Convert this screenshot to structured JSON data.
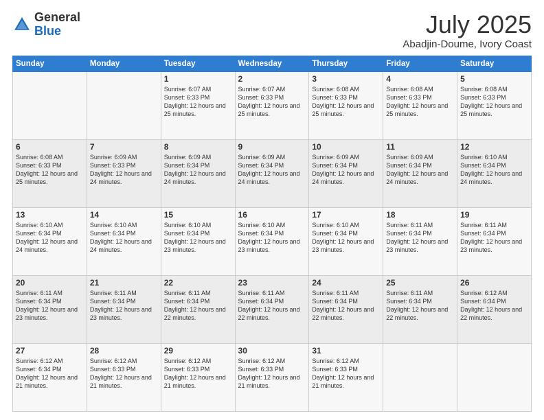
{
  "logo": {
    "line1": "General",
    "line2": "Blue"
  },
  "header": {
    "month": "July 2025",
    "location": "Abadjin-Doume, Ivory Coast"
  },
  "weekdays": [
    "Sunday",
    "Monday",
    "Tuesday",
    "Wednesday",
    "Thursday",
    "Friday",
    "Saturday"
  ],
  "weeks": [
    [
      {
        "day": "",
        "sunrise": "",
        "sunset": "",
        "daylight": ""
      },
      {
        "day": "",
        "sunrise": "",
        "sunset": "",
        "daylight": ""
      },
      {
        "day": "1",
        "sunrise": "Sunrise: 6:07 AM",
        "sunset": "Sunset: 6:33 PM",
        "daylight": "Daylight: 12 hours and 25 minutes."
      },
      {
        "day": "2",
        "sunrise": "Sunrise: 6:07 AM",
        "sunset": "Sunset: 6:33 PM",
        "daylight": "Daylight: 12 hours and 25 minutes."
      },
      {
        "day": "3",
        "sunrise": "Sunrise: 6:08 AM",
        "sunset": "Sunset: 6:33 PM",
        "daylight": "Daylight: 12 hours and 25 minutes."
      },
      {
        "day": "4",
        "sunrise": "Sunrise: 6:08 AM",
        "sunset": "Sunset: 6:33 PM",
        "daylight": "Daylight: 12 hours and 25 minutes."
      },
      {
        "day": "5",
        "sunrise": "Sunrise: 6:08 AM",
        "sunset": "Sunset: 6:33 PM",
        "daylight": "Daylight: 12 hours and 25 minutes."
      }
    ],
    [
      {
        "day": "6",
        "sunrise": "Sunrise: 6:08 AM",
        "sunset": "Sunset: 6:33 PM",
        "daylight": "Daylight: 12 hours and 25 minutes."
      },
      {
        "day": "7",
        "sunrise": "Sunrise: 6:09 AM",
        "sunset": "Sunset: 6:33 PM",
        "daylight": "Daylight: 12 hours and 24 minutes."
      },
      {
        "day": "8",
        "sunrise": "Sunrise: 6:09 AM",
        "sunset": "Sunset: 6:34 PM",
        "daylight": "Daylight: 12 hours and 24 minutes."
      },
      {
        "day": "9",
        "sunrise": "Sunrise: 6:09 AM",
        "sunset": "Sunset: 6:34 PM",
        "daylight": "Daylight: 12 hours and 24 minutes."
      },
      {
        "day": "10",
        "sunrise": "Sunrise: 6:09 AM",
        "sunset": "Sunset: 6:34 PM",
        "daylight": "Daylight: 12 hours and 24 minutes."
      },
      {
        "day": "11",
        "sunrise": "Sunrise: 6:09 AM",
        "sunset": "Sunset: 6:34 PM",
        "daylight": "Daylight: 12 hours and 24 minutes."
      },
      {
        "day": "12",
        "sunrise": "Sunrise: 6:10 AM",
        "sunset": "Sunset: 6:34 PM",
        "daylight": "Daylight: 12 hours and 24 minutes."
      }
    ],
    [
      {
        "day": "13",
        "sunrise": "Sunrise: 6:10 AM",
        "sunset": "Sunset: 6:34 PM",
        "daylight": "Daylight: 12 hours and 24 minutes."
      },
      {
        "day": "14",
        "sunrise": "Sunrise: 6:10 AM",
        "sunset": "Sunset: 6:34 PM",
        "daylight": "Daylight: 12 hours and 24 minutes."
      },
      {
        "day": "15",
        "sunrise": "Sunrise: 6:10 AM",
        "sunset": "Sunset: 6:34 PM",
        "daylight": "Daylight: 12 hours and 23 minutes."
      },
      {
        "day": "16",
        "sunrise": "Sunrise: 6:10 AM",
        "sunset": "Sunset: 6:34 PM",
        "daylight": "Daylight: 12 hours and 23 minutes."
      },
      {
        "day": "17",
        "sunrise": "Sunrise: 6:10 AM",
        "sunset": "Sunset: 6:34 PM",
        "daylight": "Daylight: 12 hours and 23 minutes."
      },
      {
        "day": "18",
        "sunrise": "Sunrise: 6:11 AM",
        "sunset": "Sunset: 6:34 PM",
        "daylight": "Daylight: 12 hours and 23 minutes."
      },
      {
        "day": "19",
        "sunrise": "Sunrise: 6:11 AM",
        "sunset": "Sunset: 6:34 PM",
        "daylight": "Daylight: 12 hours and 23 minutes."
      }
    ],
    [
      {
        "day": "20",
        "sunrise": "Sunrise: 6:11 AM",
        "sunset": "Sunset: 6:34 PM",
        "daylight": "Daylight: 12 hours and 23 minutes."
      },
      {
        "day": "21",
        "sunrise": "Sunrise: 6:11 AM",
        "sunset": "Sunset: 6:34 PM",
        "daylight": "Daylight: 12 hours and 23 minutes."
      },
      {
        "day": "22",
        "sunrise": "Sunrise: 6:11 AM",
        "sunset": "Sunset: 6:34 PM",
        "daylight": "Daylight: 12 hours and 22 minutes."
      },
      {
        "day": "23",
        "sunrise": "Sunrise: 6:11 AM",
        "sunset": "Sunset: 6:34 PM",
        "daylight": "Daylight: 12 hours and 22 minutes."
      },
      {
        "day": "24",
        "sunrise": "Sunrise: 6:11 AM",
        "sunset": "Sunset: 6:34 PM",
        "daylight": "Daylight: 12 hours and 22 minutes."
      },
      {
        "day": "25",
        "sunrise": "Sunrise: 6:11 AM",
        "sunset": "Sunset: 6:34 PM",
        "daylight": "Daylight: 12 hours and 22 minutes."
      },
      {
        "day": "26",
        "sunrise": "Sunrise: 6:12 AM",
        "sunset": "Sunset: 6:34 PM",
        "daylight": "Daylight: 12 hours and 22 minutes."
      }
    ],
    [
      {
        "day": "27",
        "sunrise": "Sunrise: 6:12 AM",
        "sunset": "Sunset: 6:34 PM",
        "daylight": "Daylight: 12 hours and 21 minutes."
      },
      {
        "day": "28",
        "sunrise": "Sunrise: 6:12 AM",
        "sunset": "Sunset: 6:33 PM",
        "daylight": "Daylight: 12 hours and 21 minutes."
      },
      {
        "day": "29",
        "sunrise": "Sunrise: 6:12 AM",
        "sunset": "Sunset: 6:33 PM",
        "daylight": "Daylight: 12 hours and 21 minutes."
      },
      {
        "day": "30",
        "sunrise": "Sunrise: 6:12 AM",
        "sunset": "Sunset: 6:33 PM",
        "daylight": "Daylight: 12 hours and 21 minutes."
      },
      {
        "day": "31",
        "sunrise": "Sunrise: 6:12 AM",
        "sunset": "Sunset: 6:33 PM",
        "daylight": "Daylight: 12 hours and 21 minutes."
      },
      {
        "day": "",
        "sunrise": "",
        "sunset": "",
        "daylight": ""
      },
      {
        "day": "",
        "sunrise": "",
        "sunset": "",
        "daylight": ""
      }
    ]
  ]
}
